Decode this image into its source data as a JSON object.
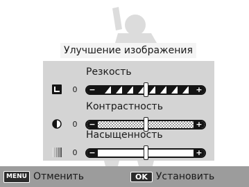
{
  "dialog": {
    "title": "Улучшение изображения"
  },
  "settings": [
    {
      "label": "Резкость",
      "value": "0",
      "level": 0.5,
      "icon": "sharpness-icon"
    },
    {
      "label": "Контрастность",
      "value": "0",
      "level": 0.5,
      "icon": "contrast-icon"
    },
    {
      "label": "Насыщенность",
      "value": "0",
      "level": 0.5,
      "icon": "saturation-icon"
    }
  ],
  "bottom_bar": {
    "cancel": {
      "key": "MENU",
      "label": "Отменить"
    },
    "confirm": {
      "key": "OK",
      "label": "Установить"
    }
  },
  "colors": {
    "panel": "#d4d4d4",
    "bar": "#9c9c9c",
    "track_fill": "#141414"
  }
}
